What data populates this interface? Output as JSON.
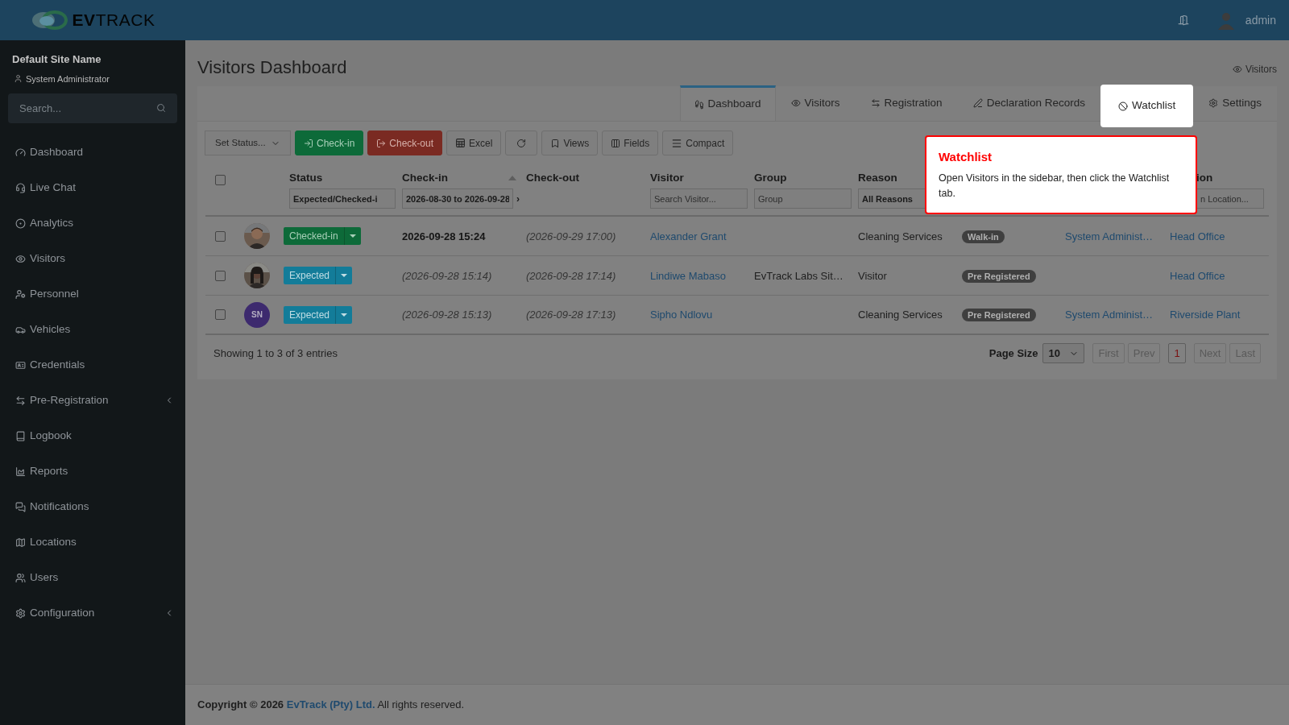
{
  "logo": {
    "bold": "EV",
    "light": "TRACK"
  },
  "topbar": {
    "user": "admin"
  },
  "sidebar": {
    "site": "Default Site Name",
    "role": "System Administrator",
    "search": {
      "placeholder": "Search..."
    },
    "items": [
      {
        "label": "Dashboard",
        "has_submenu": false
      },
      {
        "label": "Live Chat",
        "has_submenu": false
      },
      {
        "label": "Analytics",
        "has_submenu": false
      },
      {
        "label": "Visitors",
        "has_submenu": false
      },
      {
        "label": "Personnel",
        "has_submenu": false
      },
      {
        "label": "Vehicles",
        "has_submenu": false
      },
      {
        "label": "Credentials",
        "has_submenu": false
      },
      {
        "label": "Pre-Registration",
        "has_submenu": true
      },
      {
        "label": "Logbook",
        "has_submenu": false
      },
      {
        "label": "Reports",
        "has_submenu": false
      },
      {
        "label": "Notifications",
        "has_submenu": false
      },
      {
        "label": "Locations",
        "has_submenu": false
      },
      {
        "label": "Users",
        "has_submenu": false
      },
      {
        "label": "Configuration",
        "has_submenu": true
      }
    ]
  },
  "page": {
    "title": "Visitors Dashboard",
    "breadcrumb": "Visitors"
  },
  "tabs": [
    {
      "label": "Dashboard",
      "selected": true,
      "highlighted": false
    },
    {
      "label": "Visitors",
      "selected": false,
      "highlighted": false
    },
    {
      "label": "Registration",
      "selected": false,
      "highlighted": false
    },
    {
      "label": "Declaration Records",
      "selected": false,
      "highlighted": false
    },
    {
      "label": "Watchlist",
      "selected": false,
      "highlighted": true
    },
    {
      "label": "Settings",
      "selected": false,
      "highlighted": false
    }
  ],
  "toolbar": {
    "set_status": "Set Status...",
    "buttons": [
      {
        "kind": "checkin",
        "label": "Check-in"
      },
      {
        "kind": "checkout",
        "label": "Check-out"
      },
      {
        "kind": "excel",
        "label": "Excel"
      },
      {
        "kind": "refresh"
      },
      {
        "kind": "views",
        "label": "Views"
      },
      {
        "kind": "fields",
        "label": "Fields"
      },
      {
        "kind": "compact",
        "label": "Compact"
      }
    ]
  },
  "table": {
    "select_all": false,
    "columns": [
      {
        "label": "Status",
        "filter": {
          "kind": "text",
          "value": "Expected/Checked-i"
        }
      },
      {
        "label": "Check-in",
        "sorted": true,
        "filter": {
          "kind": "range",
          "value": "2026-08-30 to 2026-09-28",
          "extra": "›"
        }
      },
      {
        "label": "Check-out"
      },
      {
        "label": "Visitor",
        "filter": {
          "kind": "text",
          "placeholder": "Search Visitor..."
        }
      },
      {
        "label": "Group",
        "filter": {
          "kind": "text",
          "placeholder": "Group"
        }
      },
      {
        "label": "Reason",
        "filter": {
          "kind": "select",
          "value": "All Reasons"
        }
      },
      {
        "label": "ion",
        "filter": {
          "kind": "text",
          "placeholder": "n Location..."
        }
      }
    ],
    "rows": [
      {
        "checked": false,
        "status": {
          "kind": "checked-in",
          "label": "Checked-in"
        },
        "checkin": "2026-09-28 15:24",
        "checkin_actual": true,
        "checkout": "(2026-09-29 17:00)",
        "visitor": "Alexander Grant",
        "reason": "Cleaning Services",
        "tag": "Walk-in",
        "host": "System Administ…",
        "location": "Head Office"
      },
      {
        "checked": false,
        "status": {
          "kind": "expected",
          "label": "Expected"
        },
        "checkin": "(2026-09-28 15:14)",
        "checkin_actual": false,
        "checkout": "(2026-09-28 17:14)",
        "visitor": "Lindiwe Mabaso",
        "group": "EvTrack Labs Sit…",
        "reason": "Visitor",
        "tag": "Pre Registered",
        "location": "Head Office"
      },
      {
        "checked": false,
        "avatar": {
          "kind": "initials",
          "text": "SN",
          "color": "#3d2a6e"
        },
        "status": {
          "kind": "expected",
          "label": "Expected"
        },
        "checkin": "(2026-09-28 15:13)",
        "checkin_actual": false,
        "checkout": "(2026-09-28 17:13)",
        "visitor": "Sipho Ndlovu",
        "reason": "Cleaning Services",
        "tag": "Pre Registered",
        "host": "System Administ…",
        "location": "Riverside Plant"
      }
    ]
  },
  "pagination": {
    "summary": "Showing 1 to 3 of 3 entries",
    "page_size_label": "Page Size",
    "page_size": "10",
    "pages": [
      {
        "label": "First",
        "disabled": true,
        "selected": false
      },
      {
        "label": "Prev",
        "disabled": true,
        "selected": false
      },
      {
        "label": "1",
        "disabled": false,
        "selected": true
      },
      {
        "label": "Next",
        "disabled": true,
        "selected": false
      },
      {
        "label": "Last",
        "disabled": true,
        "selected": false
      }
    ]
  },
  "tooltip": {
    "title": "Watchlist",
    "text": "Open Visitors in the sidebar, then click the Watchlist tab."
  },
  "footer": {
    "prefix": "Copyright © 2026",
    "link": "EvTrack (Pty) Ltd.",
    "suffix": "All rights reserved."
  }
}
